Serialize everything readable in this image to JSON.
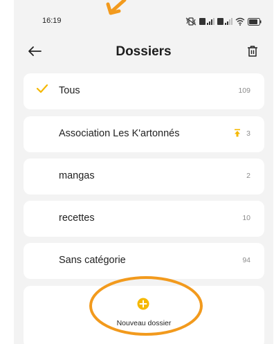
{
  "status_bar": {
    "time": "16:19"
  },
  "header": {
    "title": "Dossiers"
  },
  "folders": [
    {
      "name": "Tous",
      "count": "109",
      "selected": true,
      "pinned": false
    },
    {
      "name": "Association Les K'artonnés",
      "count": "3",
      "selected": false,
      "pinned": true
    },
    {
      "name": "mangas",
      "count": "2",
      "selected": false,
      "pinned": false
    },
    {
      "name": "recettes",
      "count": "10",
      "selected": false,
      "pinned": false
    },
    {
      "name": "Sans catégorie",
      "count": "94",
      "selected": false,
      "pinned": false
    }
  ],
  "new_folder": {
    "label": "Nouveau dossier"
  },
  "colors": {
    "accent": "#f5b800",
    "annotation": "#f29a1d",
    "background": "#f3f3f3",
    "card": "#ffffff"
  },
  "icons": [
    "back-arrow-icon",
    "trash-icon",
    "checkmark-icon",
    "pin-icon",
    "plus-circle-icon",
    "wifi-icon",
    "signal-icon",
    "battery-icon",
    "vibrate-icon"
  ]
}
